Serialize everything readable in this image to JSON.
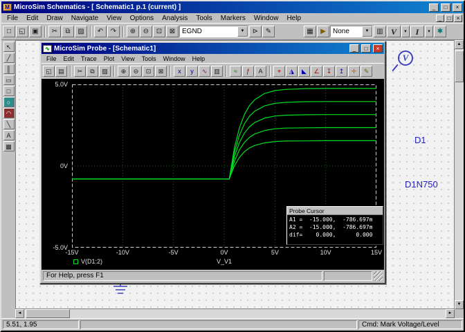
{
  "app": {
    "icon_glyph": "M",
    "title": "MicroSim Schematics  - [ Schematic1  p.1 (current) ]",
    "menu": [
      "File",
      "Edit",
      "Draw",
      "Navigate",
      "View",
      "Options",
      "Analysis",
      "Tools",
      "Markers",
      "Window",
      "Help"
    ],
    "win_buttons": {
      "minimize": "_",
      "maximize": "□",
      "close": "×"
    },
    "combo_arrow": "▼",
    "toolbarA": [
      {
        "name": "new",
        "glyph": "□"
      },
      {
        "name": "open",
        "glyph": "◱"
      },
      {
        "name": "save",
        "glyph": "▣"
      },
      {
        "sep": true
      },
      {
        "name": "cut",
        "glyph": "✂"
      },
      {
        "name": "copy",
        "glyph": "⧉"
      },
      {
        "name": "paste",
        "glyph": "▨"
      },
      {
        "sep": true
      },
      {
        "name": "undo",
        "glyph": "↶"
      },
      {
        "name": "redo",
        "glyph": "↷"
      },
      {
        "sep": true
      },
      {
        "name": "zoom-in",
        "glyph": "⊕"
      },
      {
        "name": "zoom-out",
        "glyph": "⊖"
      },
      {
        "name": "zoom-area",
        "glyph": "⊡"
      },
      {
        "name": "zoom-page",
        "glyph": "⊠"
      }
    ],
    "part_combo_value": "EGND",
    "toolbarB": [
      {
        "name": "get-new-part",
        "glyph": "⊳"
      },
      {
        "name": "edit-attributes",
        "glyph": "✎"
      },
      {
        "space": true
      },
      {
        "name": "setup-analysis",
        "glyph": "▦"
      },
      {
        "name": "simulate",
        "glyph": "▶",
        "color": "#806000"
      }
    ],
    "marker_combo_value": "None",
    "toolbarC": [
      {
        "name": "display-results",
        "glyph": "▥"
      }
    ],
    "voltage_marker_label": "V",
    "current_marker_label": "I",
    "toolbarD": [
      {
        "name": "mark-advanced",
        "glyph": "✱",
        "color": "#007777"
      }
    ],
    "left_palette": [
      {
        "name": "select-tool",
        "glyph": "↖"
      },
      {
        "name": "wire-tool",
        "glyph": "╱"
      },
      {
        "name": "bus-tool",
        "glyph": "║"
      },
      {
        "name": "block-tool",
        "glyph": "▭"
      },
      {
        "name": "rect-tool",
        "glyph": "□"
      },
      {
        "name": "circle-tool",
        "glyph": "○",
        "bg": "#2e8b8b",
        "color": "#ffffff"
      },
      {
        "name": "arc-tool",
        "glyph": "◠",
        "bg": "#8b2e2e",
        "color": "#ffffff"
      },
      {
        "name": "line-tool",
        "glyph": "╲"
      },
      {
        "name": "text-tool",
        "glyph": "A"
      },
      {
        "name": "picture-tool",
        "glyph": "▩"
      }
    ],
    "status_coords": "5.51, 1.95",
    "status_cmd": "Cmd: Mark Voltage/Level"
  },
  "scrollbar": {
    "up": "▲",
    "down": "▼",
    "left": "◄",
    "right": "►"
  },
  "schematic": {
    "marker_label": "V",
    "part_ref": "D1",
    "part_value": "D1N750"
  },
  "probe": {
    "icon_glyph": "∿",
    "title": "MicroSim Probe  - [Schematic1]",
    "menu": [
      "File",
      "Edit",
      "Trace",
      "Plot",
      "View",
      "Tools",
      "Window",
      "Help"
    ],
    "win_buttons": {
      "minimize": "_",
      "maximize": "□",
      "close": "×"
    },
    "toolbar": [
      {
        "name": "open",
        "glyph": "◱"
      },
      {
        "name": "print",
        "glyph": "▤"
      },
      {
        "sep": true
      },
      {
        "name": "cut",
        "glyph": "✂"
      },
      {
        "name": "copy",
        "glyph": "⧉"
      },
      {
        "name": "paste",
        "glyph": "▨"
      },
      {
        "sep": true
      },
      {
        "name": "zoom-in",
        "glyph": "⊕"
      },
      {
        "name": "zoom-out",
        "glyph": "⊖"
      },
      {
        "name": "zoom-area",
        "glyph": "⊡"
      },
      {
        "name": "zoom-fit",
        "glyph": "⊠"
      },
      {
        "sep": true
      },
      {
        "name": "log-x-axis",
        "glyph": "x",
        "color": "#000080"
      },
      {
        "name": "log-y-axis",
        "glyph": "y",
        "color": "#000080"
      },
      {
        "name": "fourier",
        "glyph": "∿",
        "color": "#990099"
      },
      {
        "name": "performance-analysis",
        "glyph": "▥"
      },
      {
        "sep": true
      },
      {
        "name": "add-trace",
        "glyph": "≈",
        "color": "#008800"
      },
      {
        "name": "eval-goal-function",
        "glyph": "ƒ",
        "color": "#880000"
      },
      {
        "name": "text-label",
        "glyph": "A"
      },
      {
        "sep": true
      },
      {
        "name": "toggle-cursor",
        "glyph": "⌖",
        "color": "#bb0000"
      },
      {
        "name": "cursor-peak",
        "glyph": "◮",
        "color": "#0000bb"
      },
      {
        "name": "cursor-trough",
        "glyph": "◣",
        "color": "#0000bb"
      },
      {
        "name": "cursor-slope",
        "glyph": "∠",
        "color": "#bb0000"
      },
      {
        "name": "cursor-min",
        "glyph": "↧",
        "color": "#bb0000"
      },
      {
        "name": "cursor-max",
        "glyph": "↥",
        "color": "#0000bb"
      },
      {
        "name": "cursor-point",
        "glyph": "✛",
        "color": "#bb6600"
      },
      {
        "name": "mark-label",
        "glyph": "✎",
        "color": "#666600"
      }
    ],
    "status": "For Help, press F1",
    "cursor_box": {
      "title": "Probe Cursor",
      "rows": [
        "A1 =  -15.000,  -786.697m",
        "A2 =  -15.000,  -786.697m",
        "dif=    0.000,      0.000"
      ]
    }
  },
  "chart_data": {
    "type": "line",
    "title": "",
    "xlabel": "V_V1",
    "ylabel": "",
    "legend": [
      "V(D1:2)"
    ],
    "legend_position": "bottom-left",
    "grid": true,
    "background": "#000000",
    "trace_color": "#00dd22",
    "xlim": [
      -15,
      15
    ],
    "ylim": [
      -5,
      5
    ],
    "x_ticks": [
      -15,
      -10,
      -5,
      0,
      5,
      10,
      15
    ],
    "x_tick_labels": [
      "-15V",
      "-10V",
      "-5V",
      "0V",
      "5V",
      "10V",
      "15V"
    ],
    "y_ticks": [
      5,
      0,
      -5
    ],
    "y_tick_labels": [
      "5.0V",
      "0V",
      "-5.0V"
    ],
    "series": [
      {
        "name": "V(D1:2) branch 1",
        "points": [
          [
            -15,
            -0.787
          ],
          [
            0.5,
            -0.787
          ],
          [
            1,
            1.1
          ],
          [
            1.5,
            2.34
          ],
          [
            2,
            3.16
          ],
          [
            2.5,
            3.71
          ],
          [
            3,
            4.06
          ],
          [
            4,
            4.45
          ],
          [
            5,
            4.62
          ],
          [
            6,
            4.69
          ],
          [
            8,
            4.74
          ],
          [
            10,
            4.75
          ],
          [
            15,
            4.75
          ]
        ]
      },
      {
        "name": "V(D1:2) branch 2",
        "points": [
          [
            -15,
            -0.787
          ],
          [
            0.5,
            -0.787
          ],
          [
            1,
            0.83
          ],
          [
            1.5,
            1.89
          ],
          [
            2,
            2.59
          ],
          [
            2.5,
            3.06
          ],
          [
            3,
            3.36
          ],
          [
            4,
            3.69
          ],
          [
            5,
            3.84
          ],
          [
            6,
            3.9
          ],
          [
            8,
            3.94
          ],
          [
            10,
            3.95
          ],
          [
            15,
            3.95
          ]
        ]
      },
      {
        "name": "V(D1:2) branch 3",
        "points": [
          [
            -15,
            -0.787
          ],
          [
            0.5,
            -0.787
          ],
          [
            1,
            0.56
          ],
          [
            1.5,
            1.44
          ],
          [
            2,
            2.02
          ],
          [
            2.5,
            2.41
          ],
          [
            3,
            2.66
          ],
          [
            4,
            2.94
          ],
          [
            5,
            3.06
          ],
          [
            6,
            3.11
          ],
          [
            8,
            3.14
          ],
          [
            10,
            3.15
          ],
          [
            15,
            3.15
          ]
        ]
      },
      {
        "name": "V(D1:2) branch 4",
        "points": [
          [
            -15,
            -0.787
          ],
          [
            0.5,
            -0.787
          ],
          [
            1,
            0.28
          ],
          [
            1.5,
            0.99
          ],
          [
            2,
            1.45
          ],
          [
            2.5,
            1.76
          ],
          [
            3,
            1.96
          ],
          [
            4,
            2.18
          ],
          [
            5,
            2.28
          ],
          [
            6,
            2.32
          ],
          [
            8,
            2.34
          ],
          [
            10,
            2.35
          ],
          [
            15,
            2.35
          ]
        ]
      },
      {
        "name": "V(D1:2) branch 5",
        "points": [
          [
            -15,
            -0.787
          ],
          [
            0.5,
            -0.787
          ],
          [
            1,
            0.01
          ],
          [
            1.5,
            0.53
          ],
          [
            2,
            0.88
          ],
          [
            2.5,
            1.11
          ],
          [
            3,
            1.26
          ],
          [
            4,
            1.42
          ],
          [
            5,
            1.5
          ],
          [
            6,
            1.53
          ],
          [
            8,
            1.54
          ],
          [
            10,
            1.55
          ],
          [
            15,
            1.55
          ]
        ]
      }
    ],
    "cursor_readout": {
      "A1": [
        -15.0,
        -0.786697
      ],
      "A2": [
        -15.0,
        -0.786697
      ],
      "dif": [
        0.0,
        0.0
      ]
    }
  }
}
